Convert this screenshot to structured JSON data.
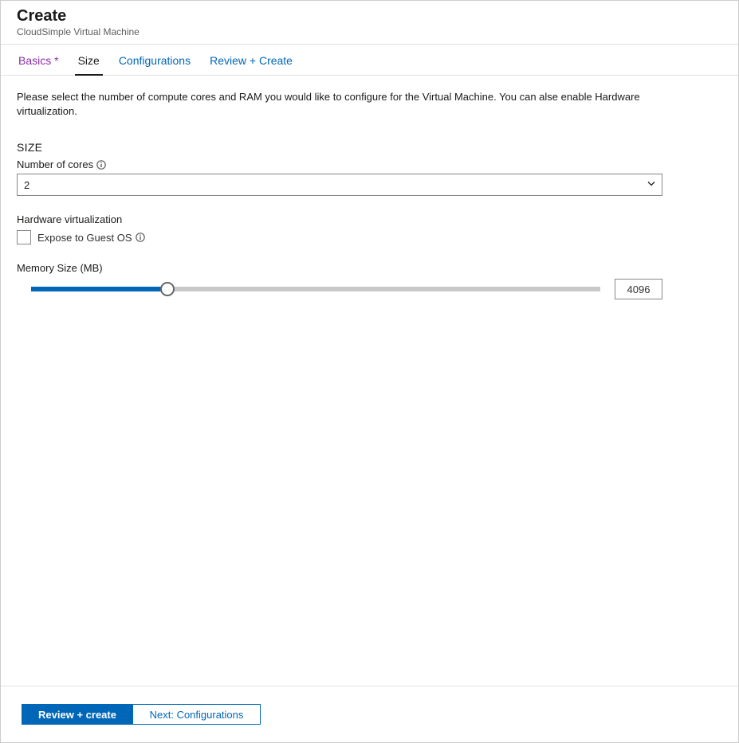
{
  "header": {
    "title": "Create",
    "subtitle": "CloudSimple Virtual Machine"
  },
  "tabs": [
    {
      "label": "Basics *",
      "state": "visited"
    },
    {
      "label": "Size",
      "state": "active"
    },
    {
      "label": "Configurations",
      "state": "default"
    },
    {
      "label": "Review + Create",
      "state": "default"
    }
  ],
  "content": {
    "intro": "Please select the number of compute cores and RAM you would like to configure for the Virtual Machine. You can alse enable Hardware virtualization.",
    "section_title": "SIZE",
    "cores": {
      "label": "Number of cores",
      "value": "2"
    },
    "hardware_virt": {
      "label": "Hardware virtualization",
      "checkbox_label": "Expose to Guest OS",
      "checked": false
    },
    "memory": {
      "label": "Memory Size (MB)",
      "value": "4096",
      "percent": 24
    }
  },
  "footer": {
    "primary": "Review + create",
    "secondary": "Next: Configurations"
  }
}
